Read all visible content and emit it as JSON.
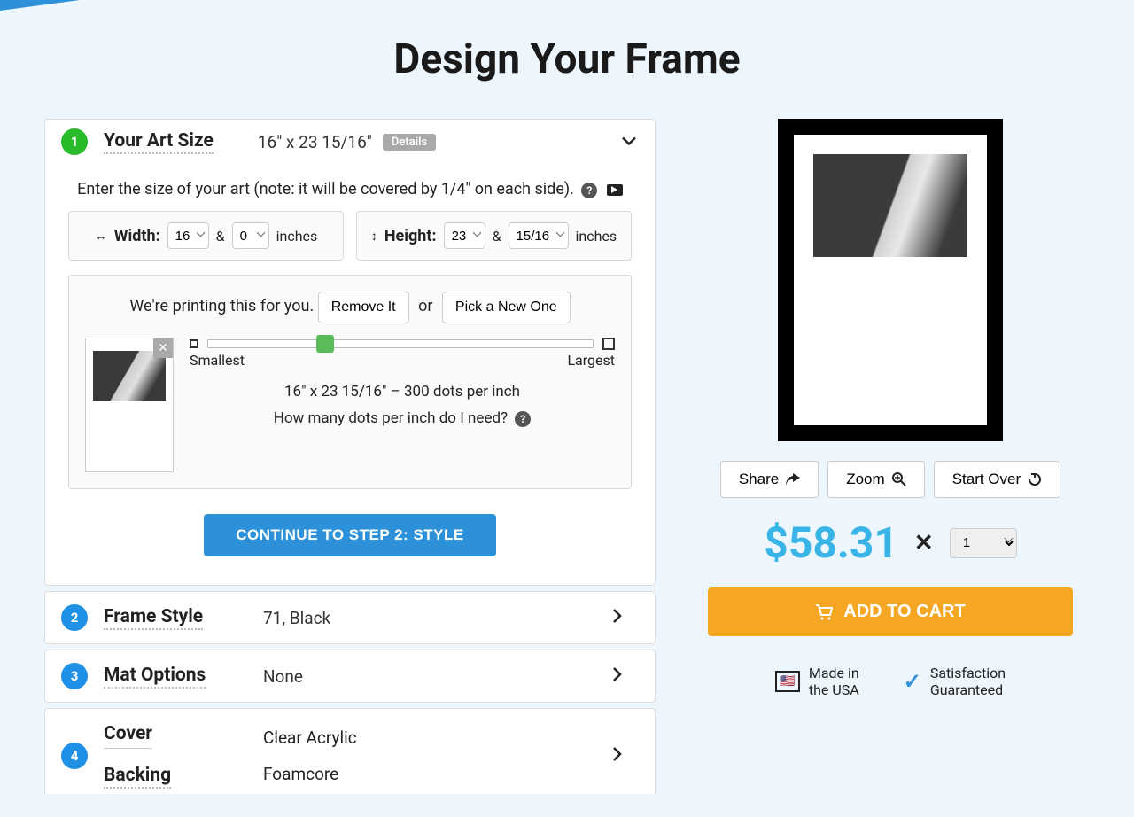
{
  "page": {
    "title": "Design Your Frame"
  },
  "step1": {
    "num": "1",
    "title": "Your Art Size",
    "summary": "16\" x 23 15/16\"",
    "details_badge": "Details",
    "instruction": "Enter the size of your art (note: it will be covered by 1/4\" on each side).",
    "width_label": "Width:",
    "height_label": "Height:",
    "amp": "&",
    "unit": "inches",
    "width_whole": "16",
    "width_frac": "0",
    "height_whole": "23",
    "height_frac": "15/16",
    "print_msg": "We're printing this for you.",
    "remove": "Remove It",
    "or": "or",
    "pick_new": "Pick a New One",
    "smallest": "Smallest",
    "largest": "Largest",
    "size_info": "16\" x 23 15/16\"   –   300 dots per inch",
    "dpi_q": "How many dots per inch do I need?",
    "continue": "CONTINUE TO STEP 2: STYLE"
  },
  "step2": {
    "num": "2",
    "title": "Frame Style",
    "summary": "71, Black"
  },
  "step3": {
    "num": "3",
    "title": "Mat Options",
    "summary": "None"
  },
  "step4": {
    "num": "4",
    "cover_label": "Cover",
    "cover_val": "Clear Acrylic",
    "backing_label": "Backing",
    "backing_val": "Foamcore"
  },
  "right": {
    "share": "Share",
    "zoom": "Zoom",
    "start_over": "Start Over",
    "price": "$58.31",
    "qty": "1",
    "add_cart": "ADD TO CART",
    "made_usa_l1": "Made in",
    "made_usa_l2": "the USA",
    "sat_l1": "Satisfaction",
    "sat_l2": "Guaranteed"
  }
}
